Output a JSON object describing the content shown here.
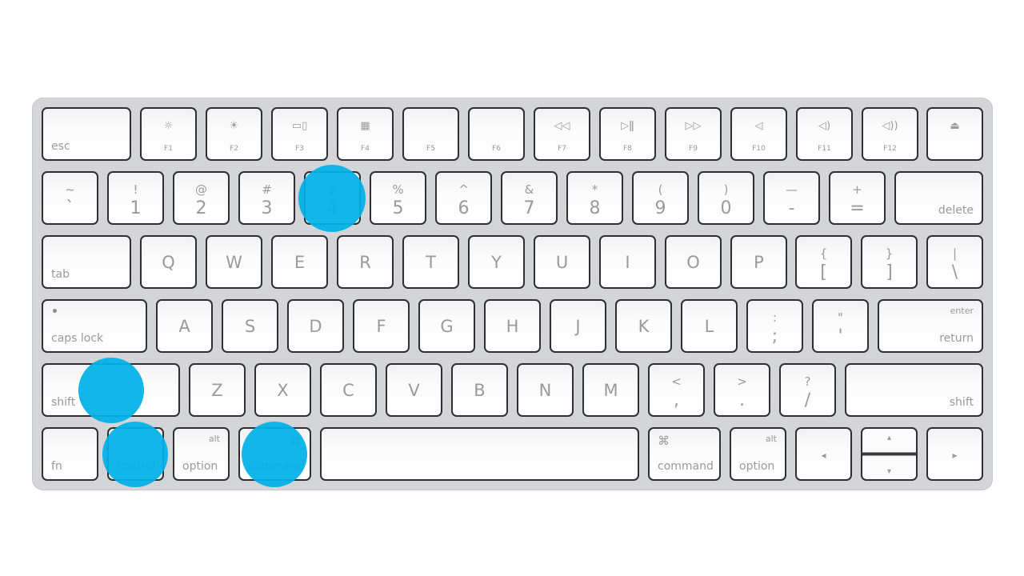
{
  "highlight_color": "#00b0e6",
  "highlighted_keys": [
    "shift",
    "control",
    "command",
    "4"
  ],
  "rows": [
    [
      {
        "bottom": "esc"
      },
      {
        "icon": "☼",
        "label": "F1"
      },
      {
        "icon": "☀",
        "label": "F2"
      },
      {
        "icon": "▭▯",
        "label": "F3"
      },
      {
        "icon": "▦",
        "label": "F4"
      },
      {
        "label": "F5"
      },
      {
        "label": "F6"
      },
      {
        "icon": "◁◁",
        "label": "F7"
      },
      {
        "icon": "▷ǁ",
        "label": "F8"
      },
      {
        "icon": "▷▷",
        "label": "F9"
      },
      {
        "icon": "◁",
        "label": "F10"
      },
      {
        "icon": "◁)",
        "label": "F11"
      },
      {
        "icon": "◁))",
        "label": "F12"
      },
      {
        "icon": "⏏"
      }
    ],
    [
      {
        "top": "~",
        "main": "`"
      },
      {
        "top": "!",
        "main": "1"
      },
      {
        "top": "@",
        "main": "2"
      },
      {
        "top": "#",
        "main": "3"
      },
      {
        "top": "$",
        "main": "4"
      },
      {
        "top": "%",
        "main": "5"
      },
      {
        "top": "^",
        "main": "6"
      },
      {
        "top": "&",
        "main": "7"
      },
      {
        "top": "*",
        "main": "8"
      },
      {
        "top": "(",
        "main": "9"
      },
      {
        "top": ")",
        "main": "0"
      },
      {
        "top": "—",
        "main": "-"
      },
      {
        "top": "+",
        "main": "="
      },
      {
        "bottom": "delete"
      }
    ],
    [
      {
        "bottom": "tab"
      },
      {
        "main": "Q"
      },
      {
        "main": "W"
      },
      {
        "main": "E"
      },
      {
        "main": "R"
      },
      {
        "main": "T"
      },
      {
        "main": "Y"
      },
      {
        "main": "U"
      },
      {
        "main": "I"
      },
      {
        "main": "O"
      },
      {
        "main": "P"
      },
      {
        "top": "{",
        "main": "["
      },
      {
        "top": "}",
        "main": "]"
      },
      {
        "top": "|",
        "main": "\\"
      }
    ],
    [
      {
        "bottom": "caps lock"
      },
      {
        "main": "A"
      },
      {
        "main": "S"
      },
      {
        "main": "D"
      },
      {
        "main": "F"
      },
      {
        "main": "G"
      },
      {
        "main": "H"
      },
      {
        "main": "J"
      },
      {
        "main": "K"
      },
      {
        "main": "L"
      },
      {
        "top": ":",
        "main": ";"
      },
      {
        "top": "\"",
        "main": "'"
      },
      {
        "top": "enter",
        "bottom": "return"
      }
    ],
    [
      {
        "bottom": "shift"
      },
      {
        "main": "Z"
      },
      {
        "main": "X"
      },
      {
        "main": "C"
      },
      {
        "main": "V"
      },
      {
        "main": "B"
      },
      {
        "main": "N"
      },
      {
        "main": "M"
      },
      {
        "top": "<",
        "main": ","
      },
      {
        "top": ">",
        "main": "."
      },
      {
        "top": "?",
        "main": "/"
      },
      {
        "bottom": "shift"
      }
    ],
    [
      {
        "bottom": "fn"
      },
      {
        "bottom": "control"
      },
      {
        "top": "alt",
        "bottom": "option"
      },
      {
        "top": "⌘",
        "bottom": "command"
      },
      {},
      {
        "top": "⌘",
        "bottom": "command"
      },
      {
        "top": "alt",
        "bottom": "option"
      },
      {
        "main": "◂"
      },
      {
        "top": "▴",
        "main": "▾"
      },
      {
        "main": "▸"
      }
    ]
  ]
}
